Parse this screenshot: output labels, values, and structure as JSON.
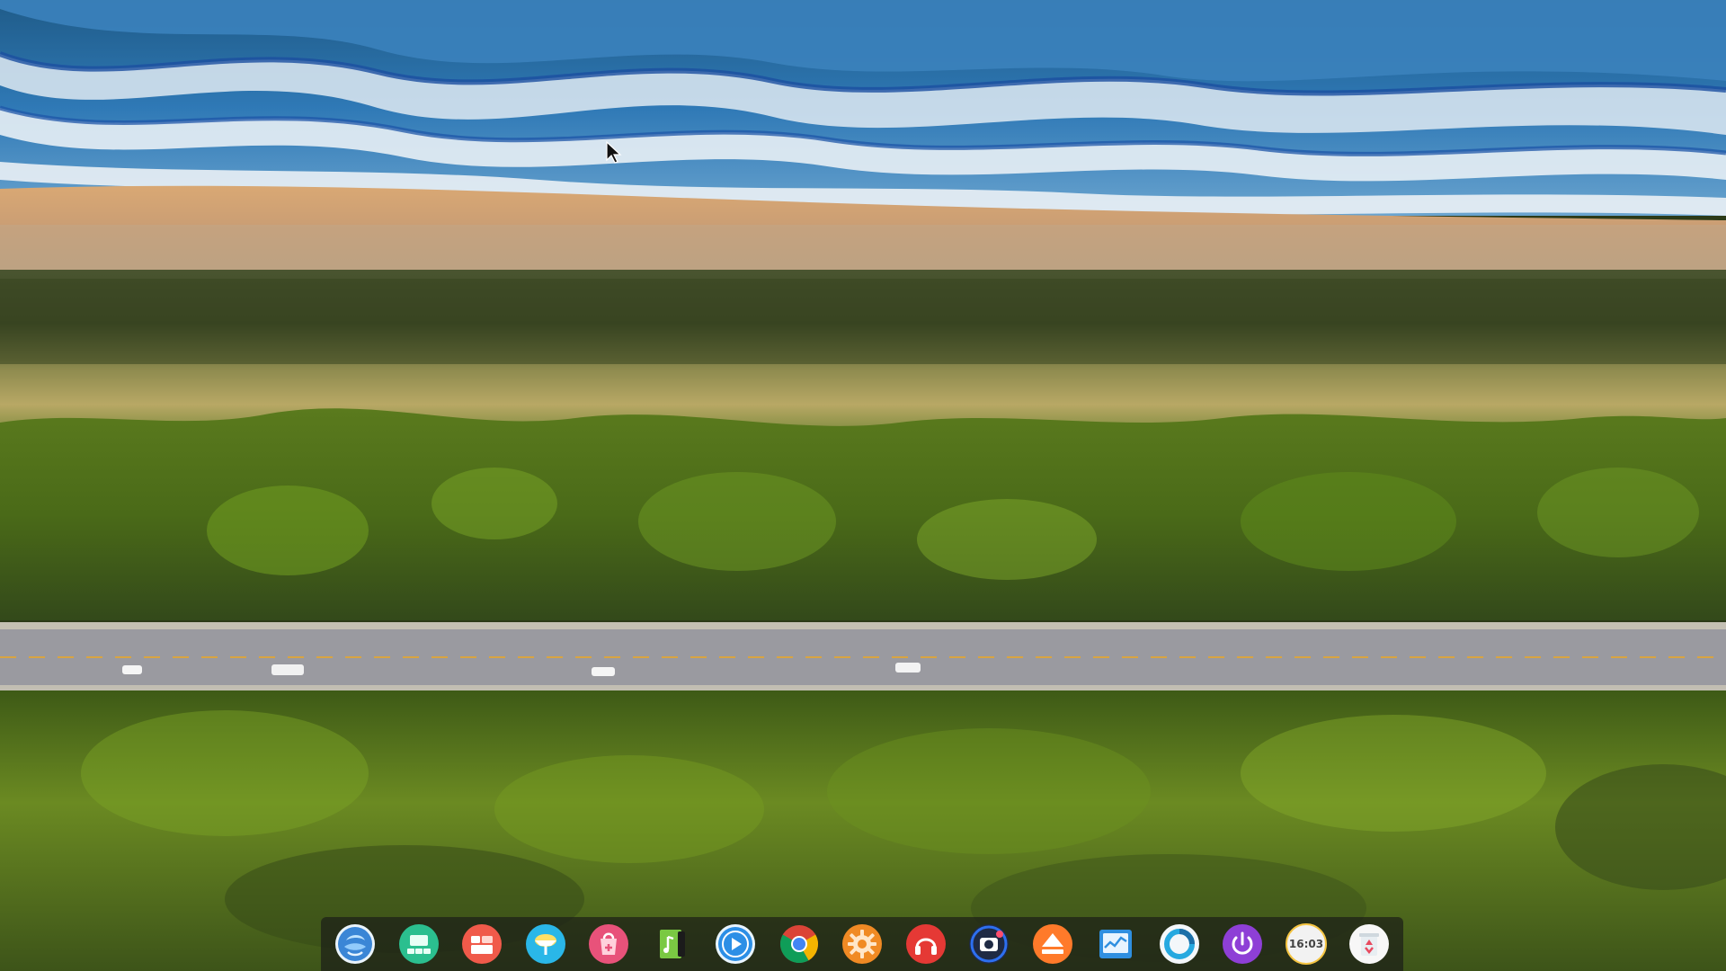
{
  "desktop": {
    "wallpaper": "aerial-coast-road-wallpaper"
  },
  "dock": {
    "items": [
      {
        "name": "launcher",
        "icon": "deepin-launcher-icon",
        "color": "#3a86d6"
      },
      {
        "name": "multitasking-view",
        "icon": "multitask-icon",
        "color": "#2bbf8f"
      },
      {
        "name": "file-manager",
        "icon": "folder-icon",
        "color": "#f05a4a"
      },
      {
        "name": "browser",
        "icon": "globe-icon",
        "color": "#2ab7e8"
      },
      {
        "name": "app-store",
        "icon": "store-icon",
        "color": "#e8527a"
      },
      {
        "name": "music",
        "icon": "music-note-icon",
        "color": "#7ac943"
      },
      {
        "name": "movie-player",
        "icon": "play-icon",
        "color": "#2c8fe6"
      },
      {
        "name": "chrome",
        "icon": "chrome-icon",
        "color": "#db4437"
      },
      {
        "name": "settings",
        "icon": "gear-icon",
        "color": "#f08a24"
      },
      {
        "name": "music-player",
        "icon": "headphone-icon",
        "color": "#e53935"
      },
      {
        "name": "screen-recorder",
        "icon": "camera-icon",
        "color": "#2d6ff0"
      },
      {
        "name": "archive-manager",
        "icon": "eject-icon",
        "color": "#ff7a2a"
      },
      {
        "name": "system-monitor",
        "icon": "monitor-icon",
        "color": "#2f8fe0"
      },
      {
        "name": "deepin-id",
        "icon": "circle-logo-icon",
        "color": "#26a9e0"
      },
      {
        "name": "shutdown",
        "icon": "power-icon",
        "color": "#8e3fd6"
      },
      {
        "name": "clock",
        "icon": "clock-icon",
        "color": "#f2f2f2"
      },
      {
        "name": "trash",
        "icon": "recycle-bin-icon",
        "color": "#e84a5f"
      }
    ],
    "clock_text": "16:03"
  }
}
